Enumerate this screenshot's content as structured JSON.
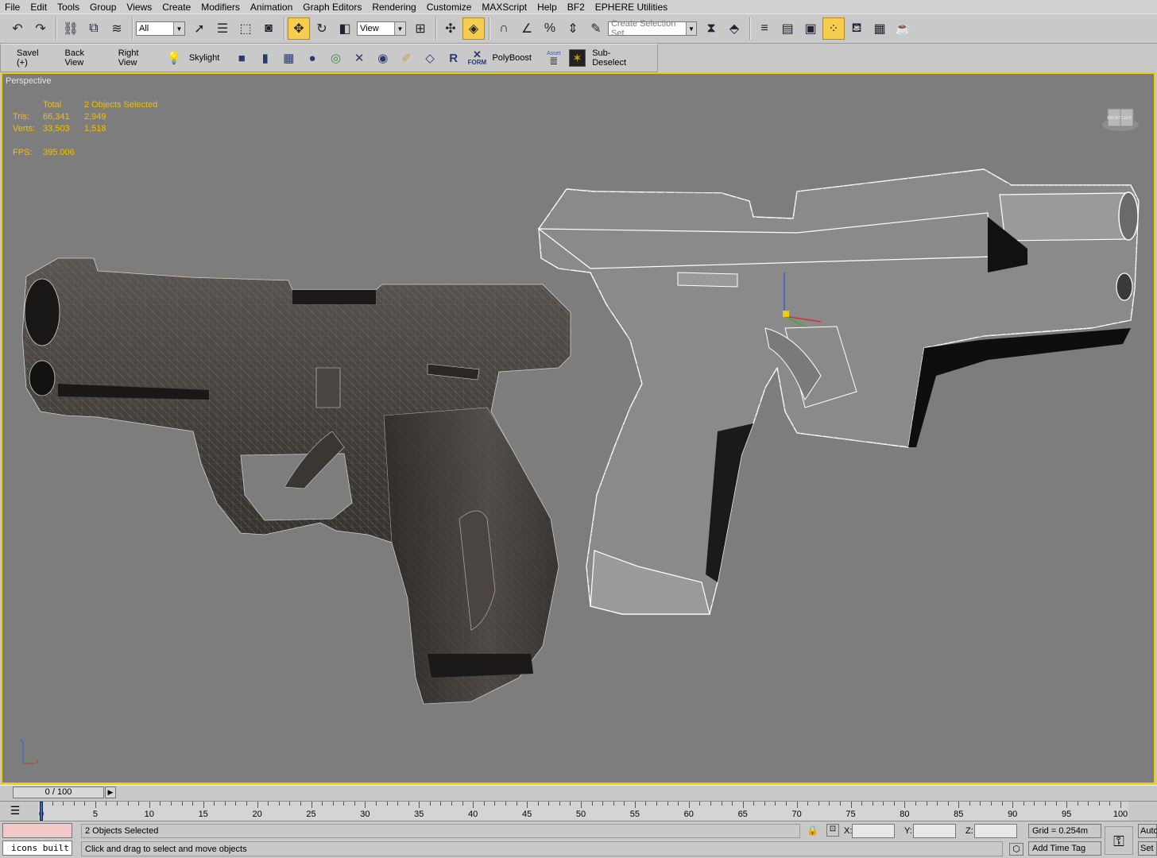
{
  "menu": [
    "File",
    "Edit",
    "Tools",
    "Group",
    "Views",
    "Create",
    "Modifiers",
    "Animation",
    "Graph Editors",
    "Rendering",
    "Customize",
    "MAXScript",
    "Help",
    "BF2",
    "EPHERE Utilities"
  ],
  "toolbar": {
    "filter_value": "All",
    "coord_value": "View",
    "selection_set_placeholder": "Create Selection Set"
  },
  "toolbar2": {
    "items": [
      "Savel (+)",
      "Back View",
      "Right View",
      "Skylight",
      "PolyBoost",
      "Sub-Deselect"
    ],
    "icon_texts": {
      "form": "FORM",
      "asset": "Asset",
      "rx": "R"
    }
  },
  "viewport": {
    "label": "Perspective",
    "stats": {
      "col_total": "Total",
      "col_selected": "2 Objects Selected",
      "tris_label": "Tris:",
      "tris_total": "66,341",
      "tris_selected": "2,949",
      "verts_label": "Verts:",
      "verts_total": "33,503",
      "verts_selected": "1,518",
      "fps_label": "FPS:",
      "fps_value": "395.006"
    },
    "viewcube": {
      "front": "FRONT",
      "left": "LEFT"
    },
    "axis": {
      "z": "z",
      "x": "x"
    }
  },
  "timeline": {
    "slider_text": "0 / 100",
    "ruler": [
      "0",
      "5",
      "10",
      "15",
      "20",
      "25",
      "30",
      "35",
      "40",
      "45",
      "50",
      "55",
      "60",
      "65",
      "70",
      "75",
      "80",
      "85",
      "90",
      "95",
      "100"
    ]
  },
  "statusbar": {
    "script_listener": "icons built",
    "selection_info": "2 Objects Selected",
    "prompt": "Click and drag to select and move objects",
    "x_label": "X:",
    "y_label": "Y:",
    "z_label": "Z:",
    "grid": "Grid = 0.254m",
    "add_time_tag": "Add Time Tag",
    "auto": "Auto",
    "set": "Set"
  },
  "colors": {
    "viewport_bg": "#7d7d7d",
    "viewport_border": "#f0d000",
    "stats_text": "#f0c000",
    "active_tool": "#f7cd50"
  }
}
